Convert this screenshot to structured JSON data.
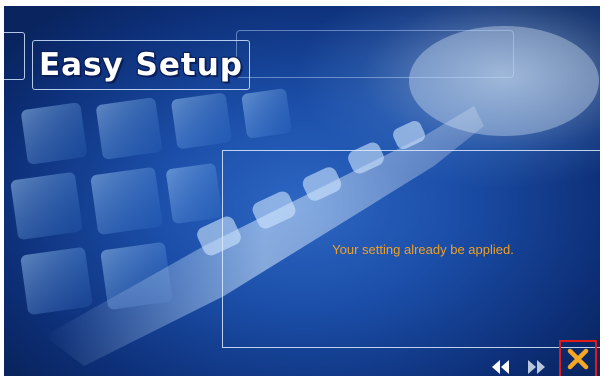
{
  "window": {
    "title": "Easy Setup"
  },
  "message": {
    "text": "Your setting already be applied."
  },
  "navigation": {
    "prev_icon": "double-chevron-left-icon",
    "next_icon": "double-chevron-right-icon",
    "close_icon": "close-icon"
  },
  "colors": {
    "background": "#1b4ea8",
    "message_text": "#f0a020",
    "close_icon": "#f5a623",
    "highlight_box": "#e21a1a"
  }
}
